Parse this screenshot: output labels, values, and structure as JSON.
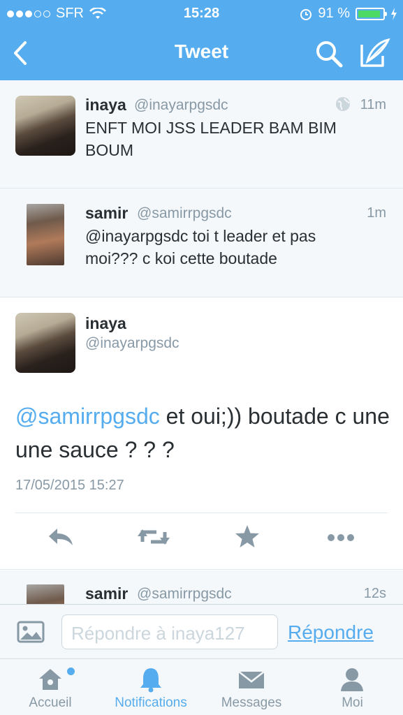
{
  "status_bar": {
    "carrier": "SFR",
    "time": "15:28",
    "battery": "91 %",
    "battery_level": 0.91,
    "signal_bars_filled": 3,
    "signal_bars_total": 5
  },
  "nav": {
    "title": "Tweet",
    "icons": [
      "chevron-left-icon",
      "search-icon",
      "compose-icon"
    ]
  },
  "tweets": [
    {
      "name": "inaya",
      "handle": "@inayarpgsdc",
      "time": "11m",
      "text": "ENFT MOI JSS LEADER BAM BIM BOUM",
      "icon": "globe-icon"
    },
    {
      "name": "samir",
      "handle": "@samirrpgsdc",
      "time": "1m",
      "text": "@inayarpgsdc toi t leader et pas moi??? c koi cette boutade"
    }
  ],
  "detail": {
    "name": "inaya",
    "handle": "@inayarpgsdc",
    "mention": "@samirrpgsdc",
    "text": " et oui;)) boutade c une une sauce ? ? ?",
    "date": "17/05/2015 15:27",
    "actions": [
      "reply-icon",
      "retweet-icon",
      "favorite-icon",
      "more-icon"
    ]
  },
  "next_tweet": {
    "name": "samir",
    "handle": "@samirrpgsdc",
    "time": "12s"
  },
  "reply_bar": {
    "placeholder": "Répondre à inaya127",
    "send_label": "Répondre",
    "icon": "photo-icon"
  },
  "tabs": [
    {
      "label": "Accueil",
      "icon": "home-icon",
      "active": false,
      "badge": true
    },
    {
      "label": "Notifications",
      "icon": "bell-icon",
      "active": true
    },
    {
      "label": "Messages",
      "icon": "envelope-icon",
      "active": false
    },
    {
      "label": "Moi",
      "icon": "person-icon",
      "active": false
    }
  ],
  "colors": {
    "brand": "#55acee",
    "text": "#292f33",
    "muted": "#8899a6",
    "battery": "#4cd964"
  }
}
